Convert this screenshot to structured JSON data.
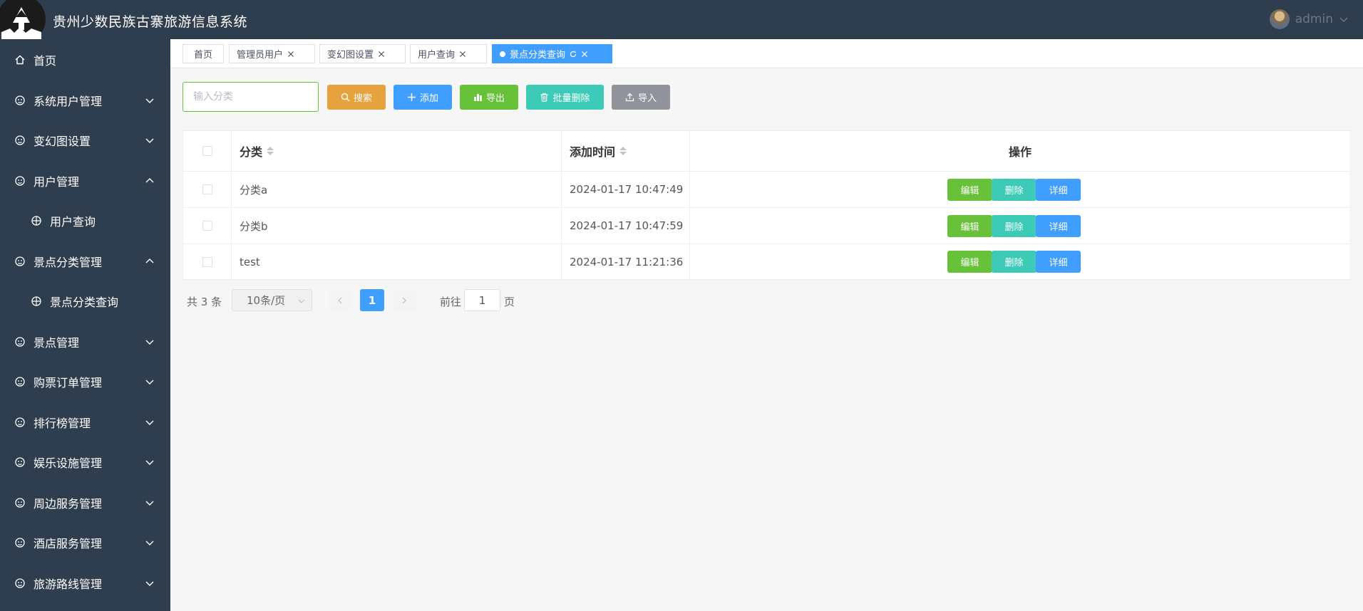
{
  "app": {
    "title": "贵州少数民族古寨旅游信息系统",
    "user": "admin"
  },
  "colors": {
    "sidebar_bg": "#2f3e4f",
    "primary": "#409eff",
    "success": "#67c23a",
    "warning": "#e6a23c",
    "teal": "#3dcbb8",
    "gray": "#909399"
  },
  "sidebar": {
    "items": [
      {
        "label": "首页",
        "icon": "home-icon",
        "arrow": ""
      },
      {
        "label": "系统用户管理",
        "icon": "menu-icon",
        "arrow": "down"
      },
      {
        "label": "变幻图设置",
        "icon": "menu-icon",
        "arrow": "down"
      },
      {
        "label": "用户管理",
        "icon": "menu-icon",
        "arrow": "up"
      },
      {
        "label": "用户查询",
        "icon": "sub-icon",
        "arrow": ""
      },
      {
        "label": "景点分类管理",
        "icon": "menu-icon",
        "arrow": "up"
      },
      {
        "label": "景点分类查询",
        "icon": "sub-icon",
        "arrow": ""
      },
      {
        "label": "景点管理",
        "icon": "menu-icon",
        "arrow": "down"
      },
      {
        "label": "购票订单管理",
        "icon": "menu-icon",
        "arrow": "down"
      },
      {
        "label": "排行榜管理",
        "icon": "menu-icon",
        "arrow": "down"
      },
      {
        "label": "娱乐设施管理",
        "icon": "menu-icon",
        "arrow": "down"
      },
      {
        "label": "周边服务管理",
        "icon": "menu-icon",
        "arrow": "down"
      },
      {
        "label": "酒店服务管理",
        "icon": "menu-icon",
        "arrow": "down"
      },
      {
        "label": "旅游路线管理",
        "icon": "menu-icon",
        "arrow": "down"
      }
    ]
  },
  "tabs": [
    {
      "label": "首页",
      "closable": false,
      "active": false
    },
    {
      "label": "管理员用户",
      "closable": true,
      "active": false
    },
    {
      "label": "变幻图设置",
      "closable": true,
      "active": false
    },
    {
      "label": "用户查询",
      "closable": true,
      "active": false
    },
    {
      "label": "景点分类查询",
      "closable": true,
      "active": true
    }
  ],
  "toolbar": {
    "search_placeholder": "输入分类",
    "search_label": "搜索",
    "add_label": "添加",
    "export_label": "导出",
    "batch_delete_label": "批量删除",
    "import_label": "导入"
  },
  "table": {
    "columns": [
      "分类",
      "添加时间",
      "操作"
    ],
    "rows": [
      {
        "category": "分类a",
        "time": "2024-01-17 10:47:49"
      },
      {
        "category": "分类b",
        "time": "2024-01-17 10:47:59"
      },
      {
        "category": "test",
        "time": "2024-01-17 11:21:36"
      }
    ],
    "actions": {
      "edit": "编辑",
      "delete": "删除",
      "detail": "详细"
    }
  },
  "pagination": {
    "total_text": "共 3 条",
    "page_size": "10条/页",
    "current_page": "1",
    "goto_label": "前往",
    "goto_value": "1",
    "page_suffix": "页"
  }
}
